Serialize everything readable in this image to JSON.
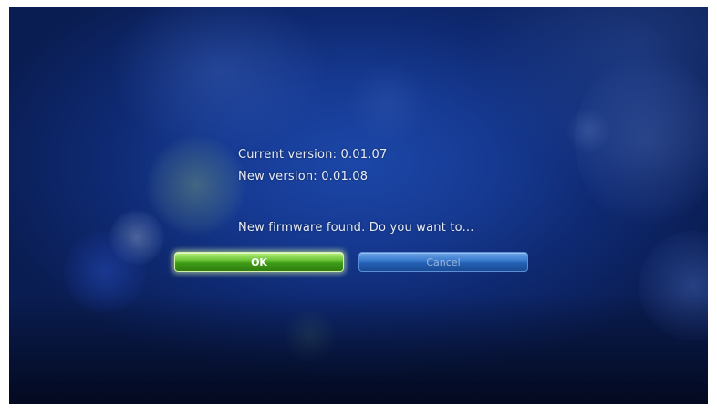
{
  "dialog": {
    "current_version": "Current version: 0.01.07",
    "new_version": "New version: 0.01.08",
    "prompt": "New firmware found. Do you want to..."
  },
  "buttons": {
    "ok_label": "OK",
    "cancel_label": "Cancel"
  },
  "colors": {
    "background": "#163a93",
    "ok_button": "#4fae22",
    "cancel_button": "#2f6fc4",
    "text": "#e6ecf8"
  }
}
